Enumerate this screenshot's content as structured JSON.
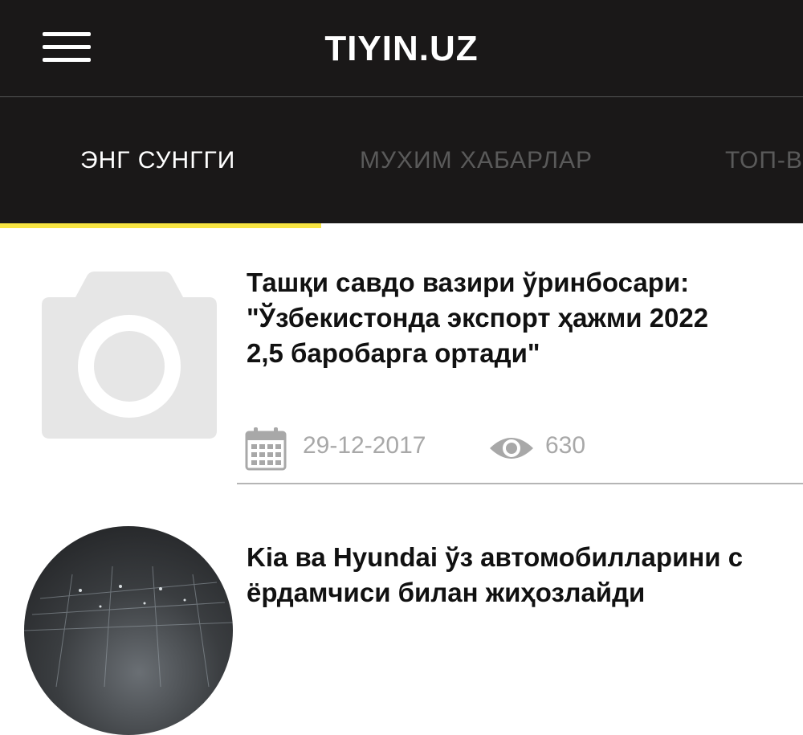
{
  "header": {
    "title": "TIYIN.UZ",
    "menu_icon": "hamburger-menu-icon",
    "background": "#1a1818"
  },
  "tabs": [
    {
      "label": "ЭНГ СУНГГИ",
      "active": true
    },
    {
      "label": "МУХИМ ХАБАРЛАР",
      "active": false
    },
    {
      "label": "ТОП-В",
      "active": false
    }
  ],
  "accent_color": "#f7e442",
  "articles": [
    {
      "title_lines": [
        "Ташқи савдо вазири ўринбосари:",
        "\"Ўзбекистонда экспорт ҳажми 2022",
        "2,5 баробарга ортади\""
      ],
      "thumbnail_icon": "camera-placeholder-icon",
      "date": "29-12-2017",
      "views": "630"
    },
    {
      "title_lines": [
        "Kia ва Hyundai ўз автомобилларини с",
        "ёрдамчиси билан жиҳозлайди"
      ],
      "thumbnail_icon": "car-photo-thumbnail"
    }
  ]
}
